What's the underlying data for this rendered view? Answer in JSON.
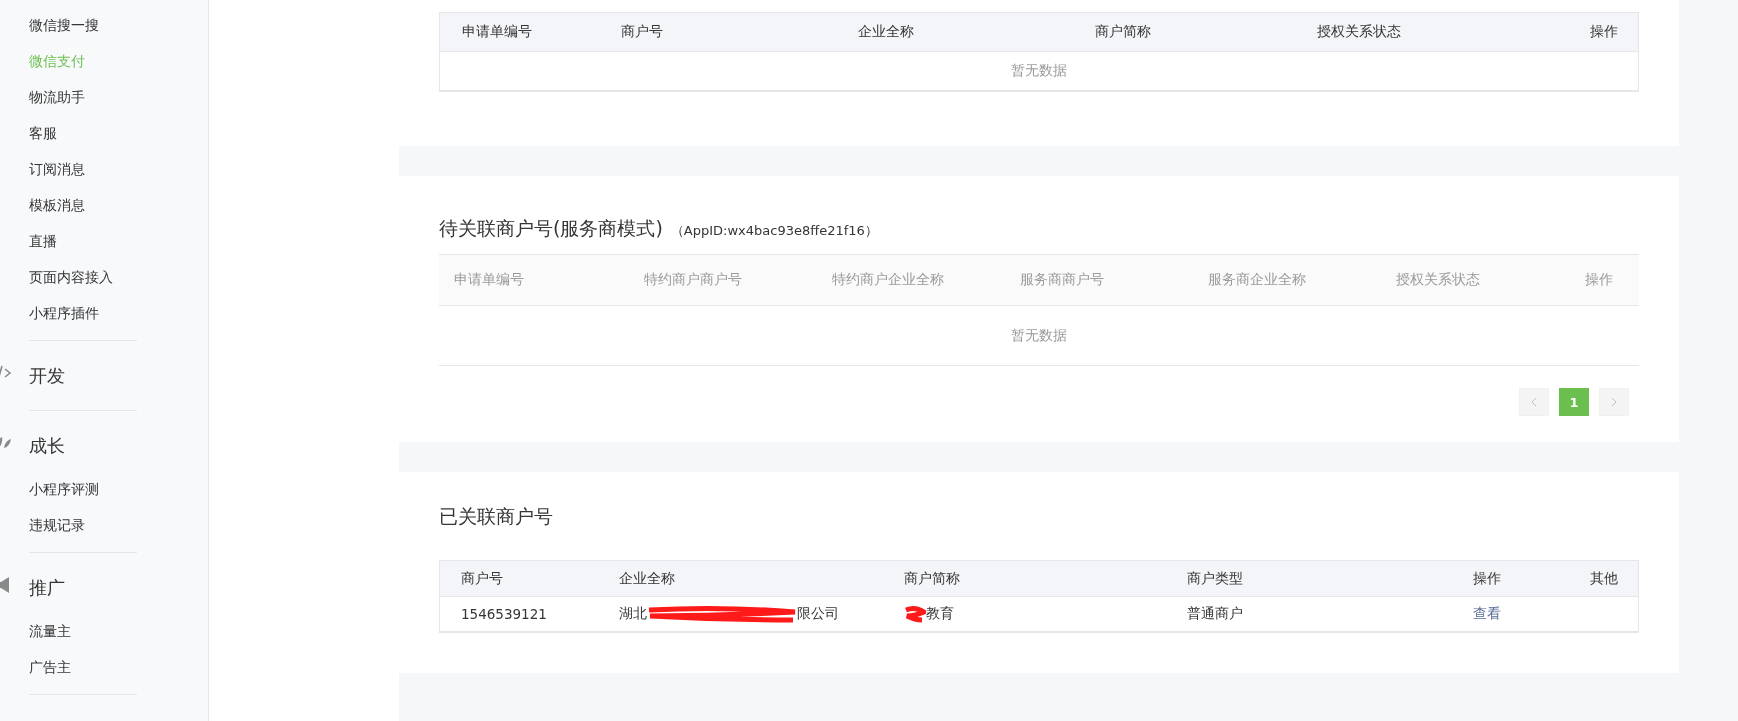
{
  "sidebar": {
    "items": [
      {
        "kind": "link",
        "label": "微信搜一搜",
        "selected": false
      },
      {
        "kind": "link",
        "label": "微信支付",
        "selected": true
      },
      {
        "kind": "link",
        "label": "物流助手",
        "selected": false
      },
      {
        "kind": "link",
        "label": "客服",
        "selected": false
      },
      {
        "kind": "link",
        "label": "订阅消息",
        "selected": false
      },
      {
        "kind": "link",
        "label": "模板消息",
        "selected": false
      },
      {
        "kind": "link",
        "label": "直播",
        "selected": false
      },
      {
        "kind": "link",
        "label": "页面内容接入",
        "selected": false
      },
      {
        "kind": "link",
        "label": "小程序插件",
        "selected": false
      },
      {
        "kind": "divider"
      },
      {
        "kind": "section",
        "label": "开发"
      },
      {
        "kind": "divider"
      },
      {
        "kind": "section",
        "label": "成长"
      },
      {
        "kind": "link",
        "label": "小程序评测",
        "selected": false
      },
      {
        "kind": "link",
        "label": "违规记录",
        "selected": false
      },
      {
        "kind": "divider"
      },
      {
        "kind": "section",
        "label": "推广"
      },
      {
        "kind": "link",
        "label": "流量主",
        "selected": false
      },
      {
        "kind": "link",
        "label": "广告主",
        "selected": false
      },
      {
        "kind": "divider"
      }
    ]
  },
  "cards": [
    {
      "kind": "plain",
      "table": {
        "columns": [
          "申请单编号",
          "商户号",
          "企业全称",
          "商户简称",
          "授权关系状态",
          "操作"
        ],
        "empty": "暂无数据"
      }
    },
    {
      "kind": "service",
      "title": "待关联商户号(服务商模式)",
      "note": "（AppID:wx4bac93e8ffe21f16）",
      "table": {
        "columns": [
          "申请单编号",
          "特约商户商户号",
          "特约商户企业全称",
          "服务商商户号",
          "服务商企业全称",
          "授权关系状态",
          "操作"
        ],
        "empty": "暂无数据"
      },
      "pagination": {
        "pages": [
          {
            "label": "1",
            "selected": true
          }
        ]
      }
    },
    {
      "kind": "linked",
      "title": "已关联商户号",
      "table": {
        "columns": [
          "商户号",
          "企业全称",
          "商户简称",
          "商户类型",
          "操作",
          "其他"
        ],
        "rows": [
          {
            "merchant_id": "1546539121",
            "company": {
              "start": "湖北",
              "end": "限公司"
            },
            "short_name": {
              "end": "教育"
            },
            "type": "普通商户",
            "action": "查看"
          }
        ]
      }
    }
  ]
}
